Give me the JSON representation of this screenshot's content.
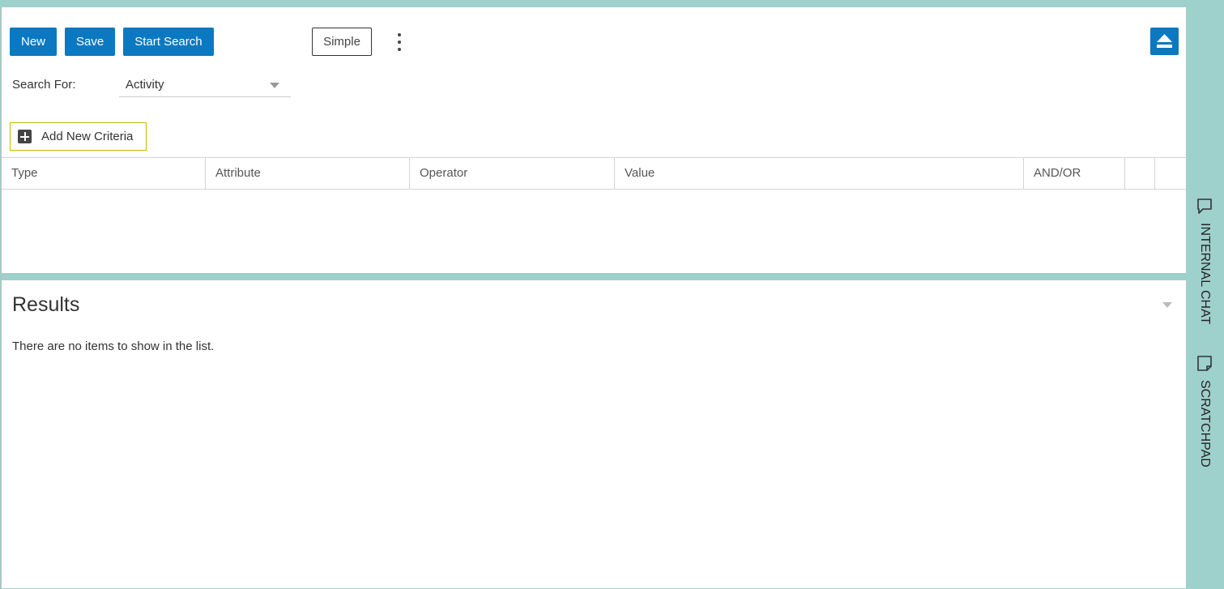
{
  "toolbar": {
    "new_label": "New",
    "save_label": "Save",
    "start_search_label": "Start Search",
    "simple_label": "Simple"
  },
  "search": {
    "label": "Search For:",
    "value": "Activity"
  },
  "criteria": {
    "add_label": "Add New Criteria",
    "columns": [
      "Type",
      "Attribute",
      "Operator",
      "Value",
      "AND/OR",
      "",
      ""
    ]
  },
  "results": {
    "title": "Results",
    "empty_message": "There are no items to show in the list."
  },
  "side_panel": {
    "items": [
      {
        "label": "INTERNAL CHAT",
        "icon": "chat-bubble-icon"
      },
      {
        "label": "SCRATCHPAD",
        "icon": "note-icon"
      }
    ]
  },
  "colors": {
    "accent": "#0b79c1",
    "teal": "#9ed0cc",
    "focus_border": "#c8b800"
  }
}
